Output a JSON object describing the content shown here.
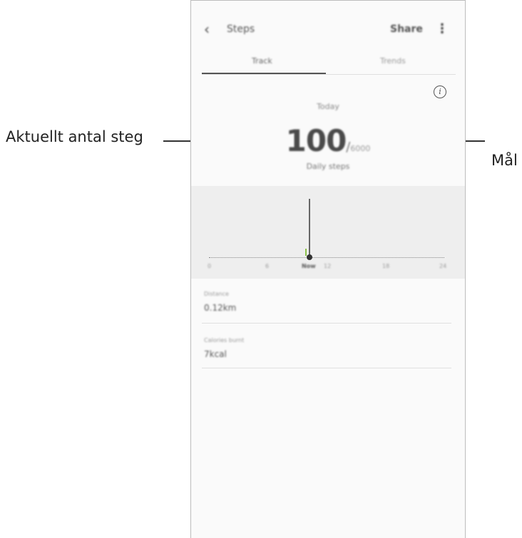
{
  "callouts": {
    "current_steps": "Aktuellt antal steg",
    "goal": "Mål"
  },
  "header": {
    "title": "Steps",
    "share_label": "Share"
  },
  "tabs": [
    {
      "label": "Track",
      "selected": true
    },
    {
      "label": "Trends",
      "selected": false
    }
  ],
  "summary": {
    "today_label": "Today",
    "steps_count": "100",
    "separator": "/",
    "goal": "6000",
    "daily_label": "Daily steps"
  },
  "chart": {
    "ticks": [
      "0",
      "6",
      "Now",
      "12",
      "18",
      "24"
    ]
  },
  "details": [
    {
      "label": "Distance",
      "value": "0.12km"
    },
    {
      "label": "Calories burnt",
      "value": "7kcal"
    }
  ],
  "icons": {
    "back": "chevron-left-icon",
    "more": "more-vertical-icon",
    "info": "info-icon"
  },
  "colors": {
    "chart_marker": "#8bc34a",
    "chart_bg": "#eeeeee"
  }
}
